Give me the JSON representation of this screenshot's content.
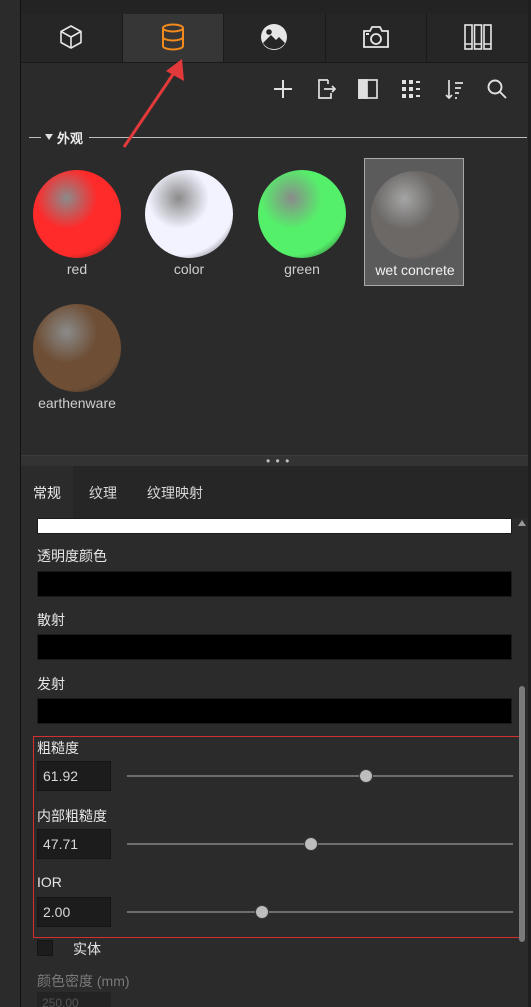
{
  "tabs": [
    {
      "id": "geometry",
      "icon": "cube-icon"
    },
    {
      "id": "materials",
      "icon": "material-cylinder-icon",
      "active": true
    },
    {
      "id": "environment",
      "icon": "landscape-icon"
    },
    {
      "id": "camera",
      "icon": "camera-icon"
    },
    {
      "id": "library",
      "icon": "books-icon"
    }
  ],
  "toolbar": [
    "add-icon",
    "export-icon",
    "panel-layout-icon",
    "grid-view-icon",
    "sort-icon",
    "search-icon"
  ],
  "section": {
    "title": "外观"
  },
  "materials": [
    {
      "label": "red",
      "color": "#ff2a2a"
    },
    {
      "label": "color",
      "color": "#f2f3ff"
    },
    {
      "label": "green",
      "color": "#55f06a"
    },
    {
      "label": "wet concrete",
      "color": "#6b6866",
      "selected": true
    },
    {
      "label": "earthenware",
      "color": "#6e4f36"
    }
  ],
  "subtabs": [
    {
      "label": "常规",
      "active": true
    },
    {
      "label": "纹理"
    },
    {
      "label": "纹理映射"
    }
  ],
  "props": {
    "top_swatch_color": "#ffffff",
    "transparency_color": {
      "label": "透明度颜色",
      "color": "#000000"
    },
    "scatter": {
      "label": "散射",
      "color": "#000000"
    },
    "emission": {
      "label": "发射",
      "color": "#000000"
    },
    "roughness": {
      "label": "粗糙度",
      "value": "61.92",
      "fraction": 0.6192
    },
    "inner_roughness": {
      "label": "内部粗糙度",
      "value": "47.71",
      "fraction": 0.4771
    },
    "ior": {
      "label": "IOR",
      "value": "2.00",
      "fraction": 0.35
    },
    "solid": {
      "label": "实体",
      "checked": false
    },
    "color_density": {
      "label": "颜色密度 (mm)",
      "value": "250.00"
    }
  },
  "colors": {
    "accent": "#f28a1c",
    "highlight": "#d23030"
  }
}
